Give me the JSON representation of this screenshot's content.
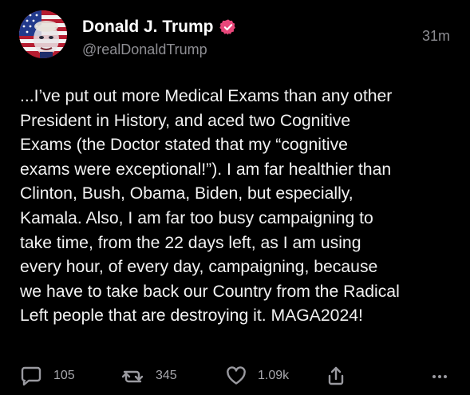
{
  "post": {
    "author_name": "Donald J. Trump",
    "handle": "@realDonaldTrump",
    "timestamp": "31m",
    "verified_icon": "verified-badge-icon",
    "verified_color": "#e8477a",
    "text": "...I’ve put out more Medical Exams than any other\nPresident in History, and aced two Cognitive\nExams (the Doctor stated that my “cognitive\nexams were exceptional!”). I am far healthier than\nClinton, Bush, Obama, Biden, but especially,\nKamala. Also, I am far too busy campaigning to\ntake time, from the 22 days left, as I am using\nevery hour, of every day, campaigning, because\nwe have to take back our Country from the Radical\nLeft people that are destroying it. MAGA2024!",
    "actions": {
      "reply_count": "105",
      "repost_count": "345",
      "like_count": "1.09k",
      "reply_icon": "reply-icon",
      "repost_icon": "repost-icon",
      "like_icon": "heart-icon",
      "share_icon": "share-icon",
      "more_icon": "more-icon"
    }
  },
  "theme": {
    "background": "#000000",
    "text_primary": "#ffffff",
    "text_secondary": "#8e8e93"
  }
}
